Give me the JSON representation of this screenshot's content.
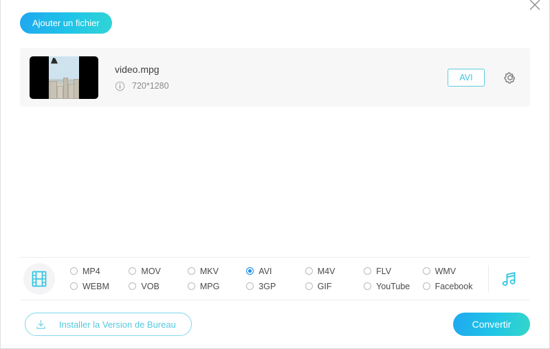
{
  "window": {
    "close_label": "×"
  },
  "toolbar": {
    "add_file_label": "Ajouter un fichier"
  },
  "file_list": [
    {
      "name": "video.mpg",
      "resolution": "720*1280",
      "target_format": "AVI"
    }
  ],
  "format_panel": {
    "video_formats": [
      {
        "label": "MP4",
        "selected": false
      },
      {
        "label": "MOV",
        "selected": false
      },
      {
        "label": "MKV",
        "selected": false
      },
      {
        "label": "AVI",
        "selected": true
      },
      {
        "label": "M4V",
        "selected": false
      },
      {
        "label": "FLV",
        "selected": false
      },
      {
        "label": "WMV",
        "selected": false
      },
      {
        "label": "WEBM",
        "selected": false
      },
      {
        "label": "VOB",
        "selected": false
      },
      {
        "label": "MPG",
        "selected": false
      },
      {
        "label": "3GP",
        "selected": false
      },
      {
        "label": "GIF",
        "selected": false
      },
      {
        "label": "YouTube",
        "selected": false
      },
      {
        "label": "Facebook",
        "selected": false
      }
    ]
  },
  "bottom_bar": {
    "install_label": "Installer la Version de Bureau",
    "convert_label": "Convertir"
  },
  "colors": {
    "accent_cyan": "#3cc4de",
    "accent_blue": "#1a8cf0",
    "gradient_start": "#1fa8f0",
    "gradient_end": "#35d6c9",
    "card_bg": "#f7f7f8"
  }
}
